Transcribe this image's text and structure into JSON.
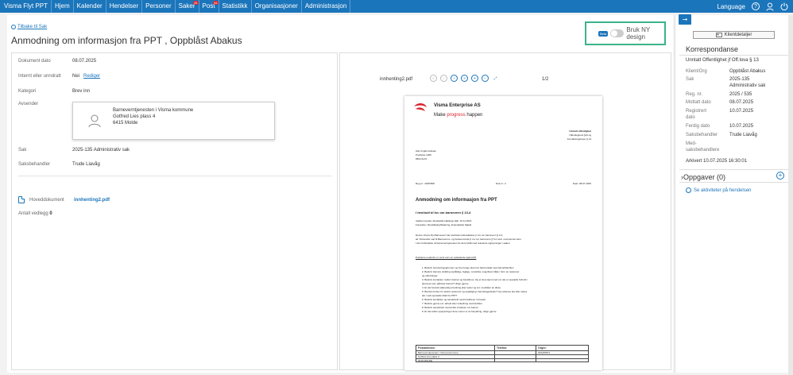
{
  "nav": {
    "items": [
      "Visma Flyt PPT",
      "Hjem",
      "Kalender",
      "Hendelser",
      "Personer",
      "Saker",
      "Post",
      "Statistikk",
      "Organisasjoner",
      "Administrasjon"
    ],
    "saker_badge": "25",
    "post_badge": "34",
    "language": "Language"
  },
  "page": {
    "back_link": "Tilbake til Sak",
    "title": "Anmodning om informasjon fra PPT , Oppblåst Abakus",
    "beta": "Beta",
    "toggle_label": "Bruk NY design"
  },
  "details": {
    "dokument_dato_label": "Dokument dato",
    "dokument_dato": "08.07.2025",
    "internt_label": "Internt eller unndratt",
    "internt": "Nei",
    "rediger": "Rediger",
    "kategori_label": "Kategori",
    "kategori": "Brev inn",
    "avsender_label": "Avsender",
    "avsender_lines": [
      "Barneverntjenesten i Visma kommune",
      "Gotfred Lies plass 4",
      "6415 Molde"
    ],
    "sak_label": "Sak",
    "sak": "2025-135 Administrativ sak",
    "saksbehandler_label": "Saksbehandler",
    "saksbehandler": "Trude Liavåg",
    "hoveddokument_label": "Hoveddokument",
    "hoveddokument": "innhenting2.pdf",
    "vedlegg_label": "Antall vedlegg",
    "vedlegg": "0"
  },
  "viewer": {
    "filename": "innhenting2.pdf",
    "page": "1/2",
    "doc": {
      "company": "Visma Enterprise AS",
      "slogan_a": "Make ",
      "slogan_b": "progress",
      "slogan_c": " happen",
      "unntatt": "Unntatt offentlighet",
      "law1": "Offentleglova §13 og",
      "law2": "Forvaltningsloven § 13",
      "addr1": "Alta Ungdomsskole",
      "addr2": "Postboks 1405",
      "addr3": "9504 ALTA",
      "ref1": "Reg.nr.: 2025/508",
      "ref2": "Dok.nr.: 2",
      "ref3": "Dato: 08.07.2025",
      "heading": "Anmodning om informasjon fra PPT",
      "subheading": "I henhold til lov om barnevern § 13-4",
      "p1": "Vedkommende: Akrobatisk Hakkspe født: 16.11.2021",
      "p2": "Foresatte: Ubestikkelig Badering, Entusiastisk Sjakal",
      "p3": "Denne Visma Flyt Barnevern har iverksatt undersøkelse jf. lov om barnevern § 2-2;",
      "p4": "alt. forbereder sak til Barneverns- og helsenemnda jf. lov om barnevern § 5-2 vedr. ovennevnte barn.",
      "p5": "I den forbindelse vil barneverntjenesten be dere bistå med relevante opplysninger i saken.",
      "p6": "Punktene nedenfor er ment som en veiledende spørsmål:",
      "list": [
        "1. Beskriv henvisningsgrunnen og hvor lenge dere har hatt kontakt med barnet/familien",
        "2. Beskriv barnets utvikling (språklige, faglige, motoriske, kognitive) både i form av ressurser",
        "   og utfordringer.",
        "3. Beskriv kontakten mellom barnet og foreldrene. Og er dere kjent med om det er spesielle forhold i",
        "   hjemmet som påvirker barnet? Utdyp gjerne.",
        "4. Er det foretatt sakkyndig utredning eller tester og evt. resultater av disse.",
        "5. Barnets behov for ekstra ressurser og oppfølging i barnehage/skole? Og vurderes det eller settes",
        "   det i verk spesielle tiltak fra PPT?",
        "6. Beskriv kontakten og samarbeid med foreldrene / foresatt.",
        "7. Beskriv gjerne evt. arbeid eller veiledning med familien.",
        "8. Beskriv samarbeid med andre instanser om barnet.",
        "9. Er det andre opplysninger dere mener er av betydning, utdyp gjerne."
      ],
      "tbl_h1": "Postadresse:",
      "tbl_h2": "Telefon:",
      "tbl_h3": "Orgnr:",
      "tbl_r1": "Barneverntjenesten i Visma kommune",
      "tbl_r1c3": "910225874",
      "tbl_r2": "Gotfred Lies plass 4",
      "tbl_r3": "6415 MOLDE"
    }
  },
  "panel": {
    "klient_btn": "Klientdetaljer",
    "heading": "Korrespondanse",
    "subtitle": "Unntatt Offentlighet jf Off.lova § 13",
    "rows": [
      {
        "k": "Klient/Org",
        "v": "Oppblåst Abakus"
      },
      {
        "k": "Sak",
        "v": "2025-135"
      },
      {
        "k": "",
        "v": "Administrativ sak"
      },
      {
        "k": "Reg. nr.",
        "v": "2025 / 535"
      },
      {
        "k": "Mottatt dato",
        "v": "08.07.2025"
      },
      {
        "k": "Registrert",
        "v": "10.07.2025"
      },
      {
        "k": "dato",
        "v": ""
      },
      {
        "k": "Ferdig dato",
        "v": "10.07.2025"
      },
      {
        "k": "Saksbehandler",
        "v": "Trude Liavåg"
      },
      {
        "k": "Med-",
        "v": ""
      },
      {
        "k": "saksbehandlere",
        "v": ""
      }
    ],
    "arkivert": "Arkivert 10.07.2025 16:30:01",
    "oppgaver": "Oppgaver (0)",
    "aktiviteter": "Se aktiviteter på hendelsen"
  }
}
